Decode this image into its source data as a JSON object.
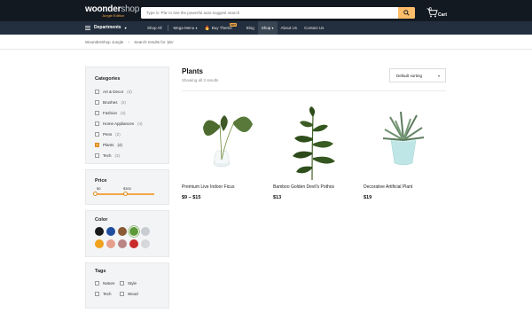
{
  "header": {
    "logo_main": "woonder",
    "logo_shop": "shop",
    "logo_sub": "Jungle Edition",
    "search_placeholder": "Type in 'Pla' to see the powerful auto-suggest search",
    "cart_count": "0",
    "cart_label": "Cart"
  },
  "nav": {
    "departments": "Departments",
    "items": [
      "Shop All",
      "Mega Menu",
      "Buy Theme",
      "Blog",
      "Shop",
      "About Us",
      "Contact Us"
    ],
    "badge": "HOT"
  },
  "breadcrumb": [
    "WoonderShop Jungle",
    "›",
    "Search results for 'pla'"
  ],
  "sidebar": {
    "categories_title": "Categories",
    "categories": [
      {
        "label": "Art & Decor",
        "count": "(3)",
        "checked": false
      },
      {
        "label": "Brushes",
        "count": "(2)",
        "checked": false
      },
      {
        "label": "Fashion",
        "count": "(3)",
        "checked": false
      },
      {
        "label": "Home Appliances",
        "count": "(4)",
        "checked": false
      },
      {
        "label": "Pens",
        "count": "(2)",
        "checked": false
      },
      {
        "label": "Plants",
        "count": "(4)",
        "checked": true
      },
      {
        "label": "Tech",
        "count": "(3)",
        "checked": false
      }
    ],
    "price_title": "Price",
    "price_min": "$0",
    "price_max": "$300",
    "color_title": "Color",
    "colors": [
      "#1a1a1a",
      "#1f4e9e",
      "#8a5a36",
      "#5d9a3a",
      "#c9ccd1",
      "#f0a11d",
      "#e6a08c",
      "#b98585",
      "#c92a2a",
      "#d5d7db"
    ],
    "tags_title": "Tags",
    "tags": [
      "Nature",
      "Style",
      "Tech",
      "Wood"
    ]
  },
  "main": {
    "title": "Plants",
    "result_count": "Showing all 3 results",
    "sort_label": "Default sorting",
    "products": [
      {
        "title": "Premium Live Indoor Ficus",
        "price": "$9 – $15"
      },
      {
        "title": "Bamboo Golden Devil's Pothos",
        "price": "$13"
      },
      {
        "title": "Decorative Artificial Plant",
        "price": "$19"
      }
    ]
  }
}
